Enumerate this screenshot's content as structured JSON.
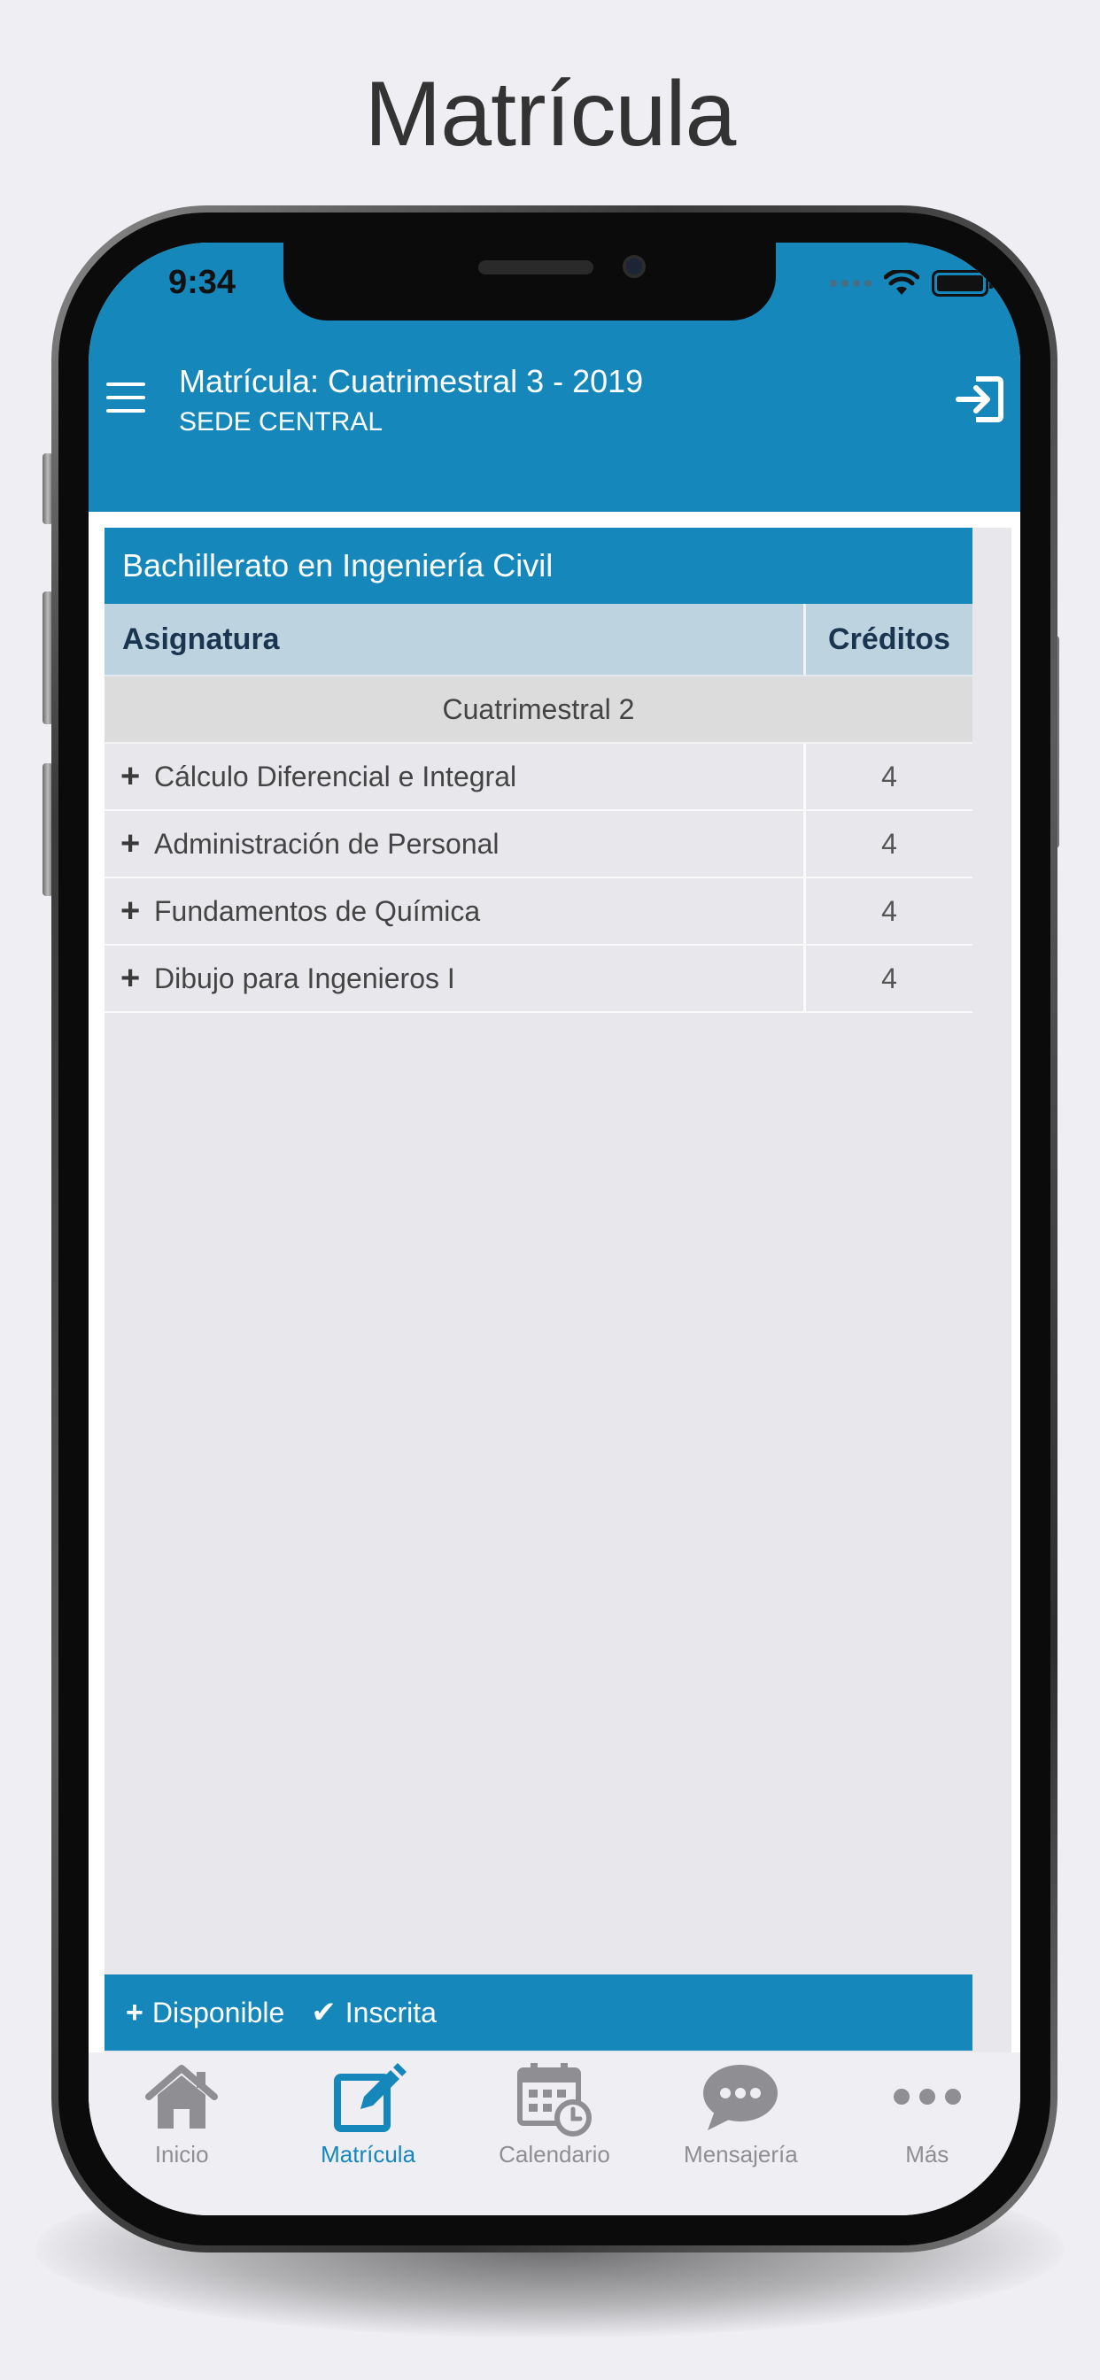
{
  "page_title": "Matrícula",
  "status_bar": {
    "time": "9:34"
  },
  "header": {
    "title": "Matrícula: Cuatrimestral 3 - 2019",
    "subtitle": "SEDE CENTRAL"
  },
  "program": {
    "name": "Bachillerato en Ingeniería Civil"
  },
  "table": {
    "col_subject": "Asignatura",
    "col_credits": "Créditos",
    "group_label": "Cuatrimestral 2",
    "rows": [
      {
        "name": "Cálculo Diferencial e Integral",
        "credits": "4"
      },
      {
        "name": "Administración de Personal",
        "credits": "4"
      },
      {
        "name": "Fundamentos de Química",
        "credits": "4"
      },
      {
        "name": "Dibujo para Ingenieros I",
        "credits": "4"
      }
    ]
  },
  "legend": {
    "available": "Disponible",
    "enrolled": "Inscrita"
  },
  "tabs": [
    {
      "label": "Inicio",
      "icon": "home-icon",
      "active": false
    },
    {
      "label": "Matrícula",
      "icon": "edit-icon",
      "active": true
    },
    {
      "label": "Calendario",
      "icon": "calendar-icon",
      "active": false
    },
    {
      "label": "Mensajería",
      "icon": "chat-icon",
      "active": false
    },
    {
      "label": "Más",
      "icon": "more-icon",
      "active": false
    }
  ],
  "colors": {
    "primary": "#1587bb",
    "table_header": "#bed3e0",
    "tab_inactive": "#8e8e93",
    "tab_active": "#1587bb"
  }
}
